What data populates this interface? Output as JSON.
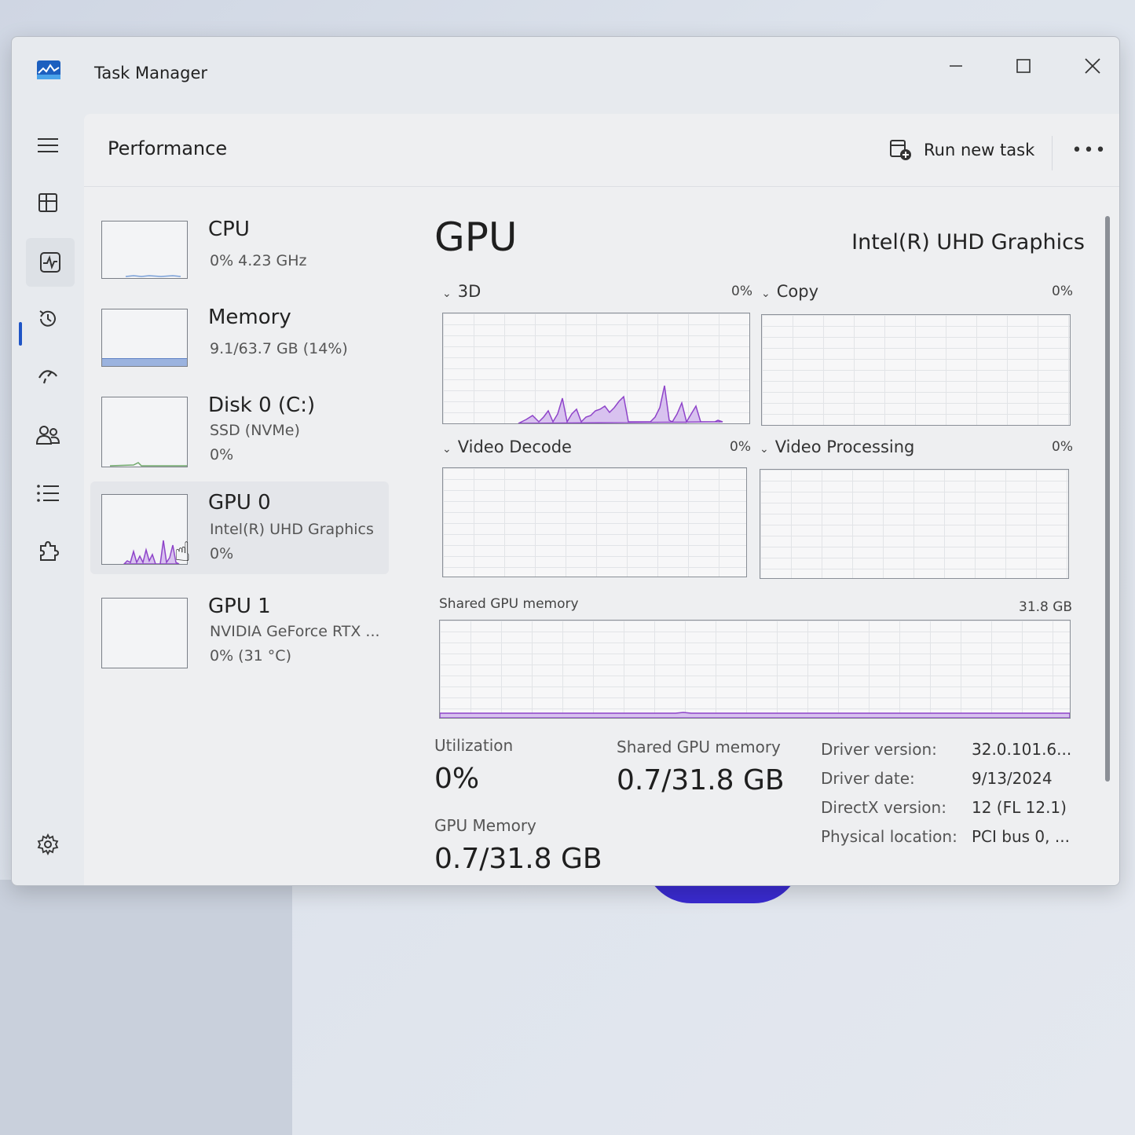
{
  "window": {
    "title": "Task Manager"
  },
  "header": {
    "title": "Performance",
    "run_new_task": "Run new task"
  },
  "devices": [
    {
      "name": "CPU",
      "line1": "0%  4.23 GHz",
      "line2": ""
    },
    {
      "name": "Memory",
      "line1": "9.1/63.7 GB (14%)",
      "line2": ""
    },
    {
      "name": "Disk 0 (C:)",
      "line1": "SSD (NVMe)",
      "line2": "0%"
    },
    {
      "name": "GPU 0",
      "line1": "Intel(R) UHD Graphics",
      "line2": "0%"
    },
    {
      "name": "GPU 1",
      "line1": "NVIDIA GeForce RTX ...",
      "line2": "0%  (31 °C)"
    }
  ],
  "gpu": {
    "title": "GPU",
    "model": "Intel(R) UHD Graphics",
    "engines": [
      {
        "label": "3D",
        "pct": "0%"
      },
      {
        "label": "Copy",
        "pct": "0%"
      },
      {
        "label": "Video Decode",
        "pct": "0%"
      },
      {
        "label": "Video Processing",
        "pct": "0%"
      }
    ],
    "shared_label": "Shared GPU memory",
    "shared_max": "31.8 GB",
    "stats": {
      "utilization_label": "Utilization",
      "utilization_value": "0%",
      "shared_label": "Shared GPU memory",
      "shared_value": "0.7/31.8 GB",
      "gpu_memory_label": "GPU Memory",
      "gpu_memory_value": "0.7/31.8 GB"
    },
    "info": [
      {
        "key": "Driver version:",
        "value": "32.0.101.6..."
      },
      {
        "key": "Driver date:",
        "value": "9/13/2024"
      },
      {
        "key": "DirectX version:",
        "value": "12 (FL 12.1)"
      },
      {
        "key": "Physical location:",
        "value": "PCI bus 0, ..."
      }
    ]
  },
  "colors": {
    "accent": "#1f55c6",
    "gpu_graph": "#8e44c9",
    "gpu_fill": "#d8c2ef",
    "memory_graph": "#9bb3df"
  }
}
